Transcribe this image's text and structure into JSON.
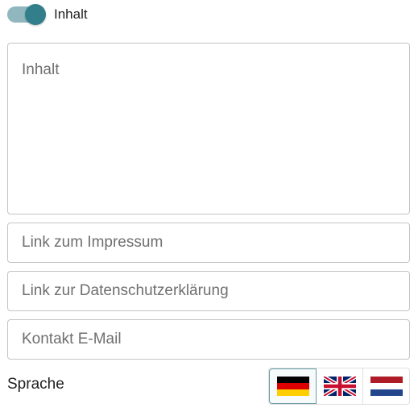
{
  "toggle": {
    "label": "Inhalt",
    "checked": true
  },
  "content": {
    "placeholder": "Inhalt"
  },
  "fields": {
    "impressum": {
      "placeholder": "Link zum Impressum"
    },
    "datenschutz": {
      "placeholder": "Link zur Datenschutzerklärung"
    },
    "email": {
      "placeholder": "Kontakt E-Mail"
    }
  },
  "language": {
    "label": "Sprache",
    "options": [
      "german-flag-icon",
      "uk-flag-icon",
      "netherlands-flag-icon"
    ],
    "selected": "german-flag-icon"
  },
  "colors": {
    "accent": "#327f8b",
    "track": "#8fb7bd",
    "border": "#c4c4c4"
  }
}
